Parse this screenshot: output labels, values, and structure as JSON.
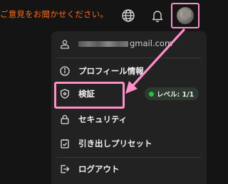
{
  "header": {
    "feedback_text": "ご意見をお聞かせください。",
    "feedback_color": "#ff6a1a",
    "globe_icon": "globe-icon",
    "bell_icon": "bell-icon",
    "avatar_icon": "avatar"
  },
  "menu": {
    "email_suffix": "gmail.com",
    "items": [
      {
        "label": "プロフィール情報",
        "icon": "info-icon"
      },
      {
        "label": "検証",
        "icon": "shield-icon"
      },
      {
        "label": "セキュリティ",
        "icon": "lock-icon"
      },
      {
        "label": "引き出しプリセット",
        "icon": "checklist-icon"
      },
      {
        "label": "ログアウト",
        "icon": "logout-icon"
      }
    ],
    "verification_badge": "レベル: 1/1",
    "badge_dot_color": "#25c247"
  },
  "annotation": {
    "highlight_color": "#ff8fc8"
  }
}
